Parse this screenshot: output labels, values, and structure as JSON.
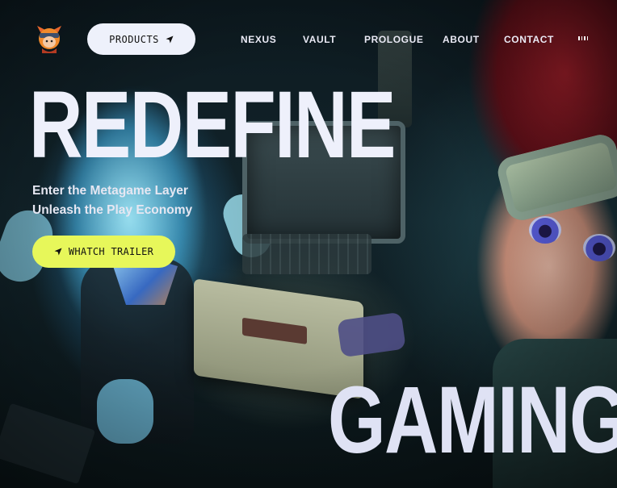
{
  "nav": {
    "products_label": "PRODUCTS",
    "items": [
      {
        "label": "NEXUS"
      },
      {
        "label": "VAULT"
      },
      {
        "label": "PROLOGUE"
      },
      {
        "label": "ABOUT"
      },
      {
        "label": "CONTACT"
      }
    ],
    "menu_icon": "audio-bars-icon",
    "logo_icon": "ninja-avatar-logo-icon",
    "products_icon": "location-arrow-icon"
  },
  "hero": {
    "title_top": "REDEFINE",
    "tagline_line1": "Enter the Metagame Layer",
    "tagline_line2": "Unleash the Play Economy",
    "cta_label": "WHATCH TRAILER",
    "cta_icon": "location-arrow-icon",
    "title_bottom": "GAMING"
  },
  "colors": {
    "cta_bg": "#e7f75a",
    "pill_bg": "#eef1fb",
    "headline": "#eef0fb"
  }
}
